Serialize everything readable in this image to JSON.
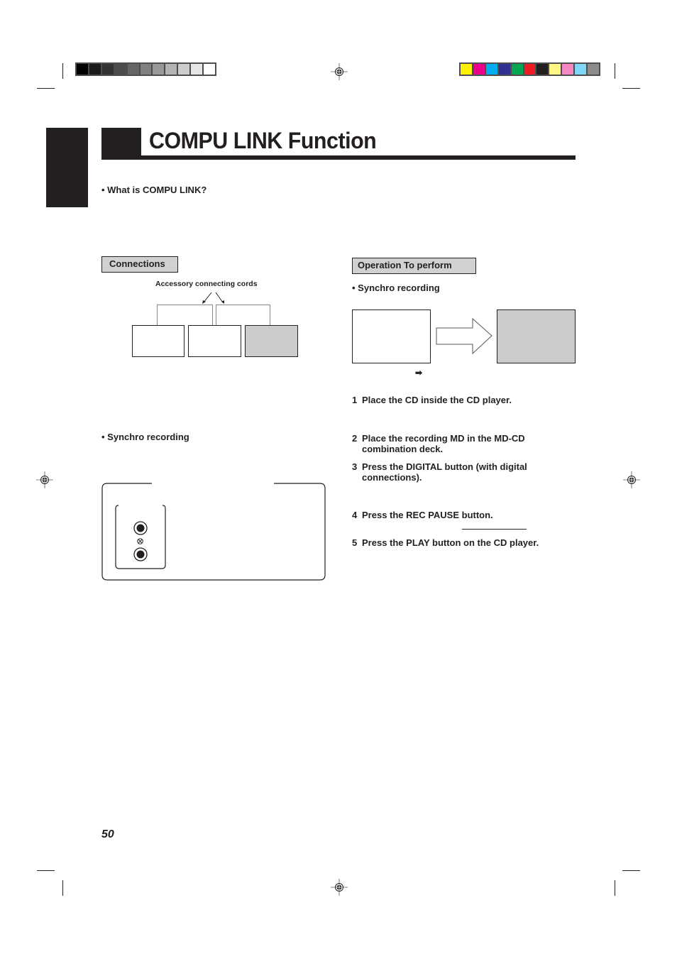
{
  "calibration": {
    "grayscale_swatches": [
      "#000000",
      "#1a1a1a",
      "#333333",
      "#4d4d4d",
      "#666666",
      "#808080",
      "#999999",
      "#b3b3b3",
      "#cccccc",
      "#e6e6e6",
      "#ffffff"
    ],
    "color_swatches": [
      "#fff200",
      "#ec008c",
      "#00aeef",
      "#2e3192",
      "#00a651",
      "#ed1c24",
      "#231f20",
      "#fff685",
      "#f587c2",
      "#7fd6f7",
      "#8c8c8c"
    ]
  },
  "icons": {
    "registration_mark": "registration-target-icon",
    "step_arrow": "➡"
  },
  "header": {
    "title": "COMPU LINK Function"
  },
  "intro": {
    "question": "• What is COMPU LINK?"
  },
  "connections": {
    "label": "Connections",
    "cords_caption": "Accessory connecting cords",
    "synchro_heading": "• Synchro recording"
  },
  "operation": {
    "label": "Operation To perform",
    "synchro_heading": "• Synchro recording",
    "arrow_glyph": "➡",
    "steps": [
      {
        "num": "1",
        "text": "Place the CD inside the CD player."
      },
      {
        "num": "2",
        "text": "Place the recording MD in the MD-CD combination deck."
      },
      {
        "num": "3",
        "text": "Press the DIGITAL button (with digital connections)."
      },
      {
        "num": "4",
        "text": "Press the REC PAUSE button."
      },
      {
        "num": "5",
        "text": "Press the PLAY button on the CD player."
      }
    ]
  },
  "footer": {
    "page_number": "50"
  }
}
